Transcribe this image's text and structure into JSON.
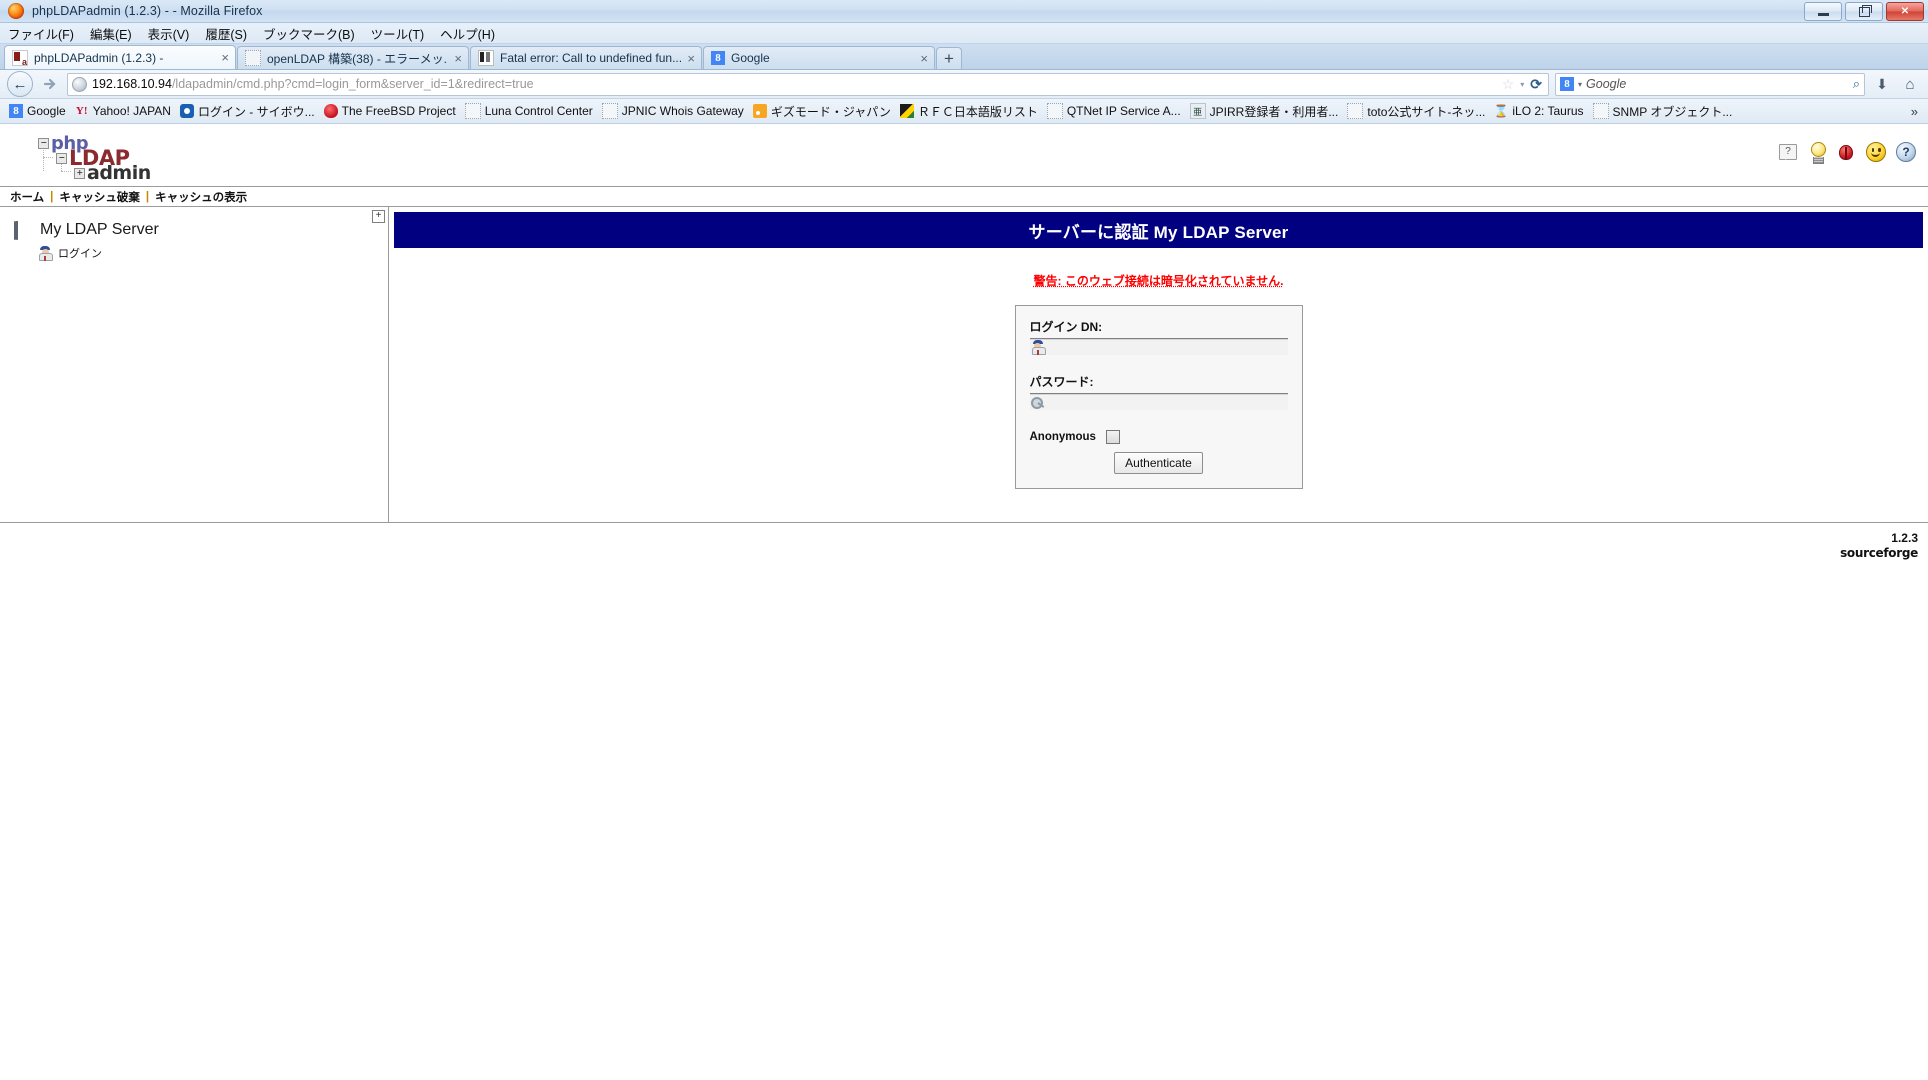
{
  "window": {
    "title": "phpLDAPadmin (1.2.3) - - Mozilla Firefox",
    "minimize_label": "",
    "restore_label": "",
    "close_label": "✕"
  },
  "menubar": {
    "items": [
      {
        "label": "ファイル(F)"
      },
      {
        "label": "編集(E)"
      },
      {
        "label": "表示(V)"
      },
      {
        "label": "履歴(S)"
      },
      {
        "label": "ブックマーク(B)"
      },
      {
        "label": "ツール(T)"
      },
      {
        "label": "ヘルプ(H)"
      }
    ]
  },
  "tabs": {
    "items": [
      {
        "label": "phpLDAPadmin (1.2.3) -",
        "favicon": "phpldap-icon",
        "close": "×",
        "active": true
      },
      {
        "label": "openLDAP 構築(38) - エラーメッ...",
        "favicon": "blank-page-icon",
        "close": "×",
        "active": false
      },
      {
        "label": "Fatal error: Call to undefined fun...",
        "favicon": "generic-icon",
        "close": "×",
        "active": false
      },
      {
        "label": "Google",
        "favicon": "google-icon",
        "close": "×",
        "active": false
      }
    ],
    "new_tab_label": "+"
  },
  "navbar": {
    "back_label": "←",
    "forward_label": "→",
    "url_host": "192.168.10.94",
    "url_path": "/ldapadmin/cmd.php?cmd=login_form&server_id=1&redirect=true",
    "star_label": "☆",
    "dropmarker_label": "▾",
    "reload_label": "⟳",
    "search_engine": "Google",
    "search_placeholder": "Google",
    "search_value": "",
    "search_go_label": "⌕",
    "download_label": "⬇",
    "home_label": "⌂"
  },
  "bookmarks": {
    "items": [
      {
        "label": "Google",
        "icon": "google-icon"
      },
      {
        "label": "Yahoo! JAPAN",
        "icon": "yahoo-icon"
      },
      {
        "label": "ログイン - サイボウ...",
        "icon": "cybozu-icon"
      },
      {
        "label": "The FreeBSD Project",
        "icon": "freebsd-daemon-icon"
      },
      {
        "label": "Luna Control Center",
        "icon": "blank-page-icon"
      },
      {
        "label": "JPNIC Whois Gateway",
        "icon": "blank-page-icon"
      },
      {
        "label": "ギズモード・ジャパン",
        "icon": "rss-icon"
      },
      {
        "label": "ＲＦＣ日本語版リスト",
        "icon": "rfc-icon"
      },
      {
        "label": "QTNet IP Service A...",
        "icon": "blank-page-icon"
      },
      {
        "label": "JPIRR登録者・利用者...",
        "icon": "jpirr-icon"
      },
      {
        "label": "toto公式サイト-ネッ...",
        "icon": "blank-page-icon"
      },
      {
        "label": "iLO 2: Taurus",
        "icon": "ilo-icon"
      },
      {
        "label": "SNMP オブジェクト...",
        "icon": "blank-page-icon"
      }
    ],
    "overflow_label": "»"
  },
  "app": {
    "logo": {
      "php": "php",
      "ldap": "LDAP",
      "admin": "admin",
      "node_collapsed": "−",
      "node_expanded": "+"
    },
    "header_icons": [
      {
        "name": "tooltip-help-icon",
        "glyph": "?"
      },
      {
        "name": "light-bulb-icon",
        "glyph": ""
      },
      {
        "name": "bug-report-icon",
        "glyph": ""
      },
      {
        "name": "smiley-icon",
        "glyph": ""
      },
      {
        "name": "help-ball-icon",
        "glyph": "?"
      }
    ],
    "nav": {
      "home": "ホーム",
      "separator": "|",
      "purge_cache": "キャッシュ破棄",
      "show_cache": "キャッシュの表示"
    },
    "tree": {
      "expand_label": "+",
      "server_label": "My LDAP Server",
      "login_label": "ログイン"
    },
    "main": {
      "title": "サーバーに認証 My LDAP Server",
      "warning": "警告: このウェブ接続は暗号化されていません.",
      "login_dn_label": "ログイン DN:",
      "login_dn_value": "",
      "password_label": "パスワード:",
      "password_value": "",
      "anonymous_label": "Anonymous",
      "anonymous_checked": false,
      "authenticate_label": "Authenticate"
    },
    "footer": {
      "version": "1.2.3",
      "project": "sourceforge"
    },
    "colors": {
      "title_bar_bg": "#000080",
      "warning_text": "#ff0000",
      "logo_php": "#5a5fa8",
      "logo_ldap": "#8b2a2f",
      "logo_admin": "#333333"
    }
  }
}
